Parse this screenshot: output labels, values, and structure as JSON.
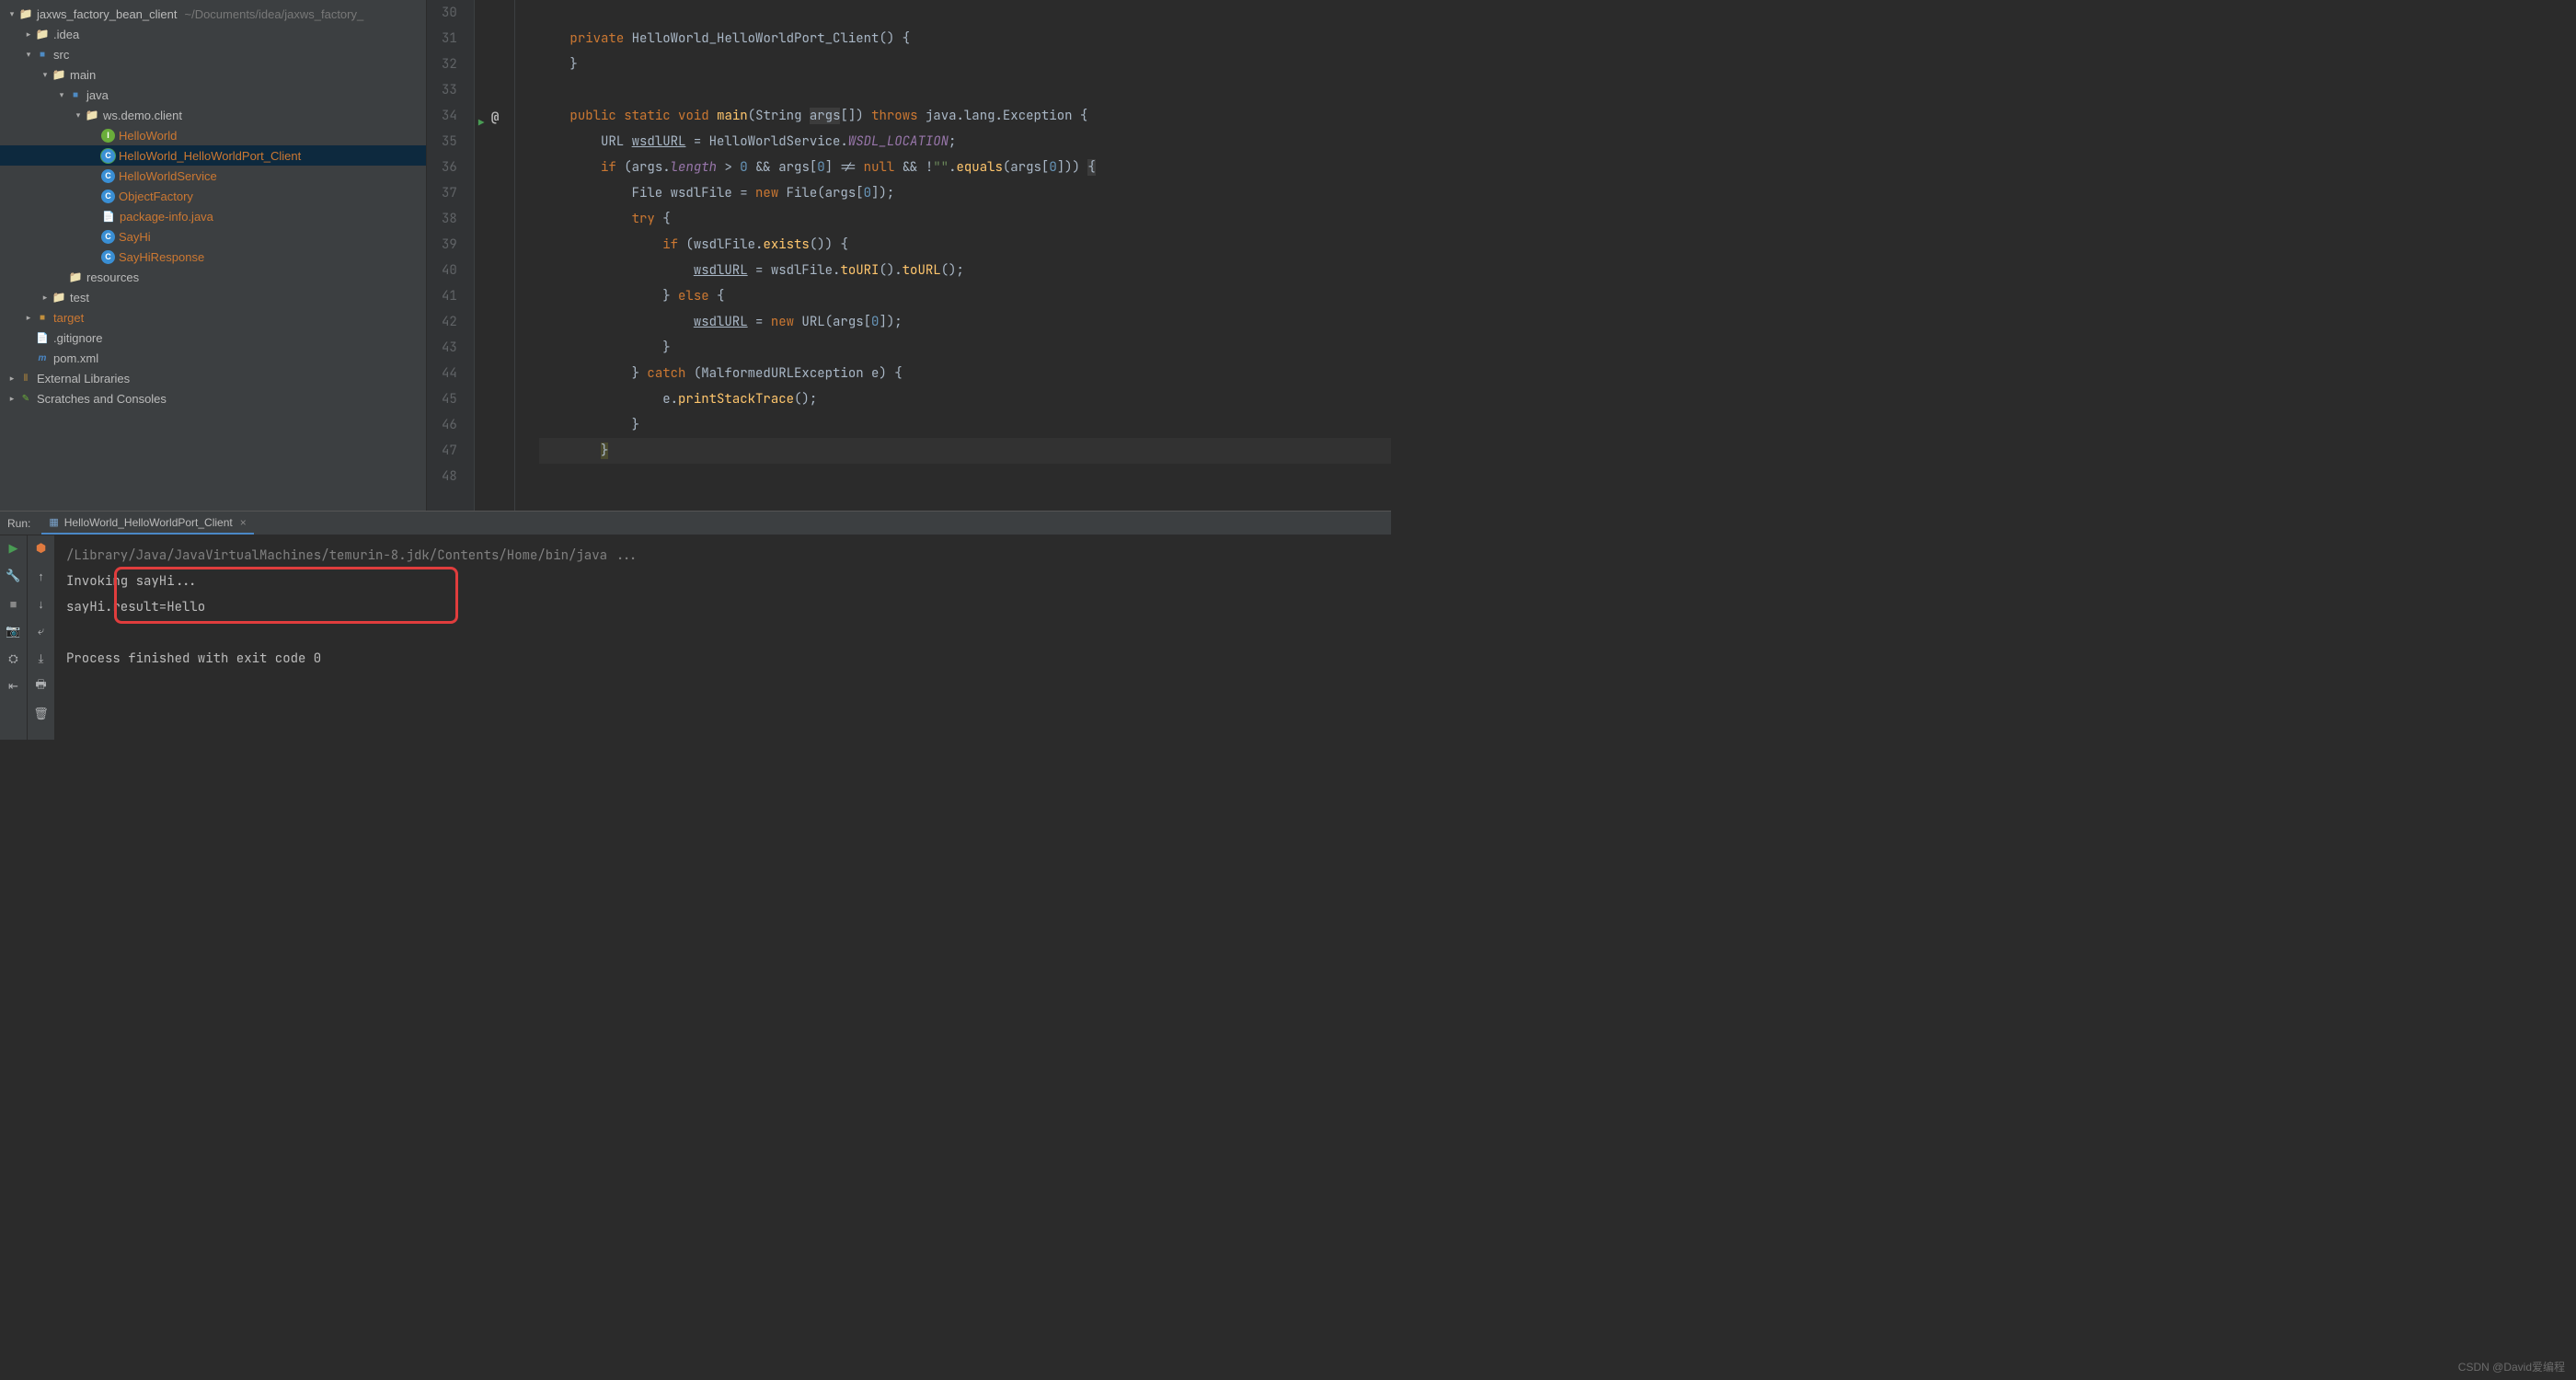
{
  "project": {
    "root": {
      "name": "jaxws_factory_bean_client",
      "path": "~/Documents/idea/jaxws_factory_"
    },
    "nodes": [
      {
        "indent": 0,
        "arrow": "down",
        "icon": "folder",
        "label": "jaxws_factory_bean_client",
        "suffixPath": "~/Documents/idea/jaxws_factory_"
      },
      {
        "indent": 1,
        "arrow": "right",
        "icon": "folder",
        "label": ".idea"
      },
      {
        "indent": 1,
        "arrow": "down",
        "icon": "folder-src",
        "label": "src"
      },
      {
        "indent": 2,
        "arrow": "down",
        "icon": "folder",
        "label": "main"
      },
      {
        "indent": 3,
        "arrow": "down",
        "icon": "folder-src",
        "label": "java"
      },
      {
        "indent": 4,
        "arrow": "down",
        "icon": "folder",
        "label": "ws.demo.client"
      },
      {
        "indent": 5,
        "arrow": "",
        "icon": "ic-i",
        "label": "HelloWorld",
        "orange": true
      },
      {
        "indent": 5,
        "arrow": "",
        "icon": "ic-c",
        "label": "HelloWorld_HelloWorldPort_Client",
        "orange": true,
        "selected": true,
        "runBadge": true
      },
      {
        "indent": 5,
        "arrow": "",
        "icon": "ic-c",
        "label": "HelloWorldService",
        "orange": true
      },
      {
        "indent": 5,
        "arrow": "",
        "icon": "ic-c",
        "label": "ObjectFactory",
        "orange": true
      },
      {
        "indent": 5,
        "arrow": "",
        "icon": "file",
        "label": "package-info.java",
        "orange": true
      },
      {
        "indent": 5,
        "arrow": "",
        "icon": "ic-c",
        "label": "SayHi",
        "orange": true
      },
      {
        "indent": 5,
        "arrow": "",
        "icon": "ic-c",
        "label": "SayHiResponse",
        "orange": true
      },
      {
        "indent": 3,
        "arrow": "",
        "icon": "folder",
        "label": "resources"
      },
      {
        "indent": 2,
        "arrow": "right",
        "icon": "folder",
        "label": "test"
      },
      {
        "indent": 1,
        "arrow": "right",
        "icon": "folder-tgt",
        "label": "target",
        "orange": true
      },
      {
        "indent": 1,
        "arrow": "",
        "icon": "file",
        "label": ".gitignore"
      },
      {
        "indent": 1,
        "arrow": "",
        "icon": "file-m",
        "label": "pom.xml"
      },
      {
        "indent": 0,
        "arrow": "right",
        "icon": "lib",
        "label": "External Libraries"
      },
      {
        "indent": 0,
        "arrow": "right",
        "icon": "scratch",
        "label": "Scratches and Consoles"
      }
    ]
  },
  "editor": {
    "startLine": 30,
    "gutterMark": {
      "line": 34,
      "run": true,
      "at": "@"
    },
    "cursorLine": 47,
    "lines": [
      "",
      "    private HelloWorld_HelloWorldPort_Client() {",
      "    }",
      "",
      "    public static void main(String args[]) throws java.lang.Exception {",
      "        URL wsdlURL = HelloWorldService.WSDL_LOCATION;",
      "        if (args.length > 0 && args[0] != null && !\"\".equals(args[0])) {",
      "            File wsdlFile = new File(args[0]);",
      "            try {",
      "                if (wsdlFile.exists()) {",
      "                    wsdlURL = wsdlFile.toURI().toURL();",
      "                } else {",
      "                    wsdlURL = new URL(args[0]);",
      "                }",
      "            } catch (MalformedURLException e) {",
      "                e.printStackTrace();",
      "            }",
      "        }",
      ""
    ]
  },
  "run": {
    "label": "Run:",
    "tabName": "HelloWorld_HelloWorldPort_Client",
    "output": [
      "/Library/Java/JavaVirtualMachines/temurin-8.jdk/Contents/Home/bin/java ...",
      "Invoking sayHi...",
      "sayHi.result=Hello",
      "",
      "Process finished with exit code 0"
    ]
  },
  "watermark": "CSDN @David爱编程"
}
